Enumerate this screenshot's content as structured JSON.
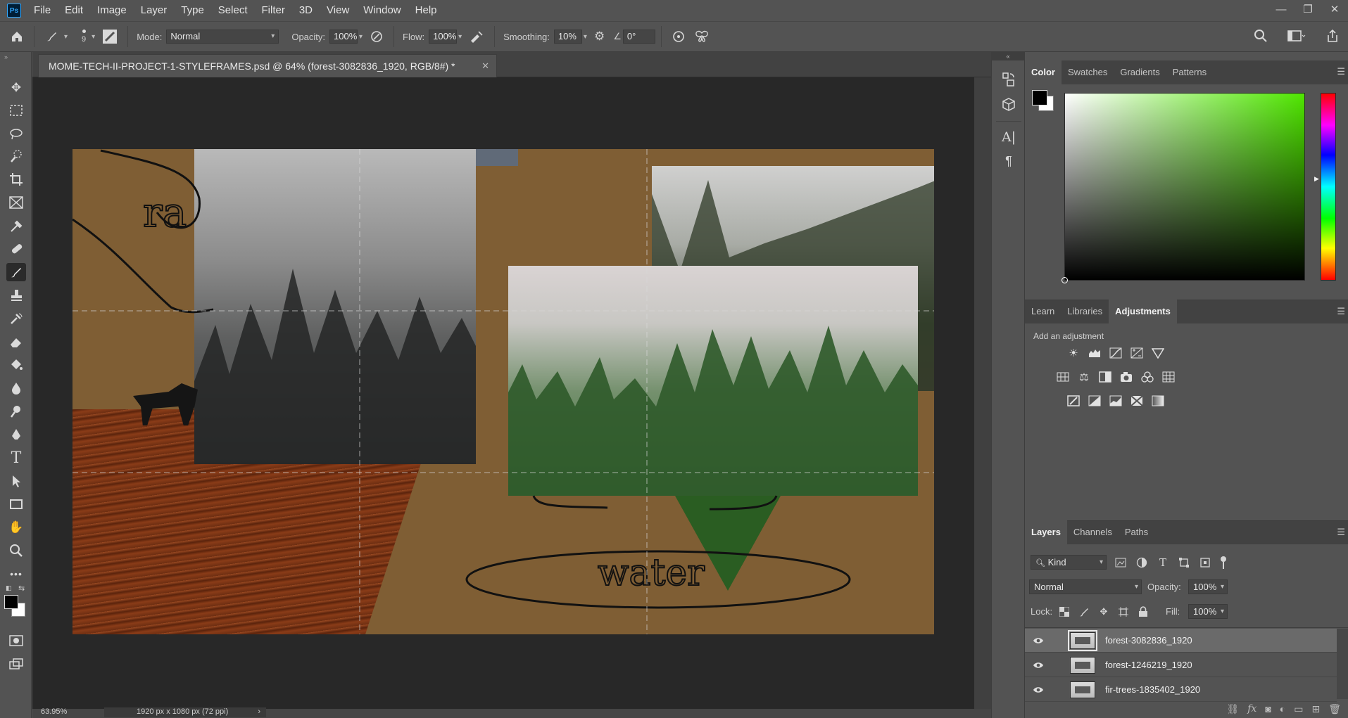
{
  "app": {
    "logo": "Ps"
  },
  "menu": [
    "File",
    "Edit",
    "Image",
    "Layer",
    "Type",
    "Select",
    "Filter",
    "3D",
    "View",
    "Window",
    "Help"
  ],
  "window_controls": {
    "minimize": "—",
    "restore": "❐",
    "close": "✕"
  },
  "options": {
    "brush_size": "9",
    "mode_label": "Mode:",
    "mode_value": "Normal",
    "opacity_label": "Opacity:",
    "opacity_value": "100%",
    "flow_label": "Flow:",
    "flow_value": "100%",
    "smoothing_label": "Smoothing:",
    "smoothing_value": "10%",
    "angle_value": "0°"
  },
  "document": {
    "tab_title": "MOME-TECH-II-PROJECT-1-STYLEFRAMES.psd @ 64% (forest-3082836_1920, RGB/8#) *",
    "tab_close": "✕",
    "status_zoom": "63.95%",
    "status_size": "1920 px x 1080 px (72 ppi)",
    "status_arrow": "›"
  },
  "canvas_text": {
    "handwriting_top": "ra",
    "handwriting_water": "water"
  },
  "color_panel": {
    "tabs": [
      "Color",
      "Swatches",
      "Gradients",
      "Patterns"
    ],
    "active_tab": 0,
    "foreground": "#000000",
    "background": "#ffffff",
    "hue": "#4fe600"
  },
  "adjustments_panel": {
    "tabs": [
      "Learn",
      "Libraries",
      "Adjustments"
    ],
    "active_tab": 2,
    "subtitle": "Add an adjustment"
  },
  "layers_panel": {
    "tabs": [
      "Layers",
      "Channels",
      "Paths"
    ],
    "active_tab": 0,
    "filter_kind": "Kind",
    "blend_mode": "Normal",
    "opacity_label": "Opacity:",
    "opacity_value": "100%",
    "lock_label": "Lock:",
    "fill_label": "Fill:",
    "fill_value": "100%",
    "layers": [
      {
        "name": "forest-3082836_1920",
        "selected": true
      },
      {
        "name": "forest-1246219_1920",
        "selected": false
      },
      {
        "name": "fir-trees-1835402_1920",
        "selected": false
      }
    ]
  },
  "icons": {
    "home": "home-icon",
    "brush": "brush-icon",
    "eye": "eye-icon",
    "menu": "hamburger-menu-icon"
  }
}
